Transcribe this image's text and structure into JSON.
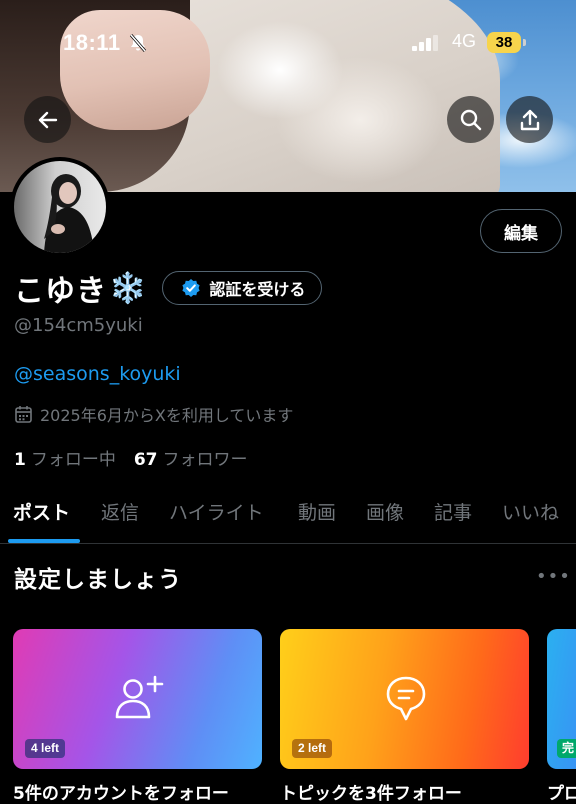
{
  "status": {
    "time": "18:11",
    "network": "4G",
    "battery": "38"
  },
  "profile": {
    "name": "こゆき",
    "name_emoji": "❄️",
    "verify_label": "認証を受ける",
    "edit_label": "編集",
    "handle": "@154cm5yuki",
    "bio_link": "@seasons_koyuki",
    "joined": "2025年6月からXを利用しています",
    "following_count": "1",
    "following_label": "フォロー中",
    "followers_count": "67",
    "followers_label": "フォロワー"
  },
  "tabs": [
    {
      "label": "ポスト",
      "active": true
    },
    {
      "label": "返信"
    },
    {
      "label": "ハイライト"
    },
    {
      "label": "動画"
    },
    {
      "label": "画像"
    },
    {
      "label": "記事"
    },
    {
      "label": "いいね"
    }
  ],
  "setup": {
    "title": "設定しましょう",
    "more": "•••",
    "cards": [
      {
        "badge": "4 left",
        "caption": "5件のアカウントをフォロー",
        "icon": "add-user-icon"
      },
      {
        "badge": "2 left",
        "caption": "トピックを3件フォロー",
        "icon": "topic-icon"
      },
      {
        "badge": "完",
        "caption": "プロ"
      }
    ]
  },
  "colors": {
    "accent": "#1d9bf0",
    "muted": "#71767b",
    "background": "#000000"
  }
}
